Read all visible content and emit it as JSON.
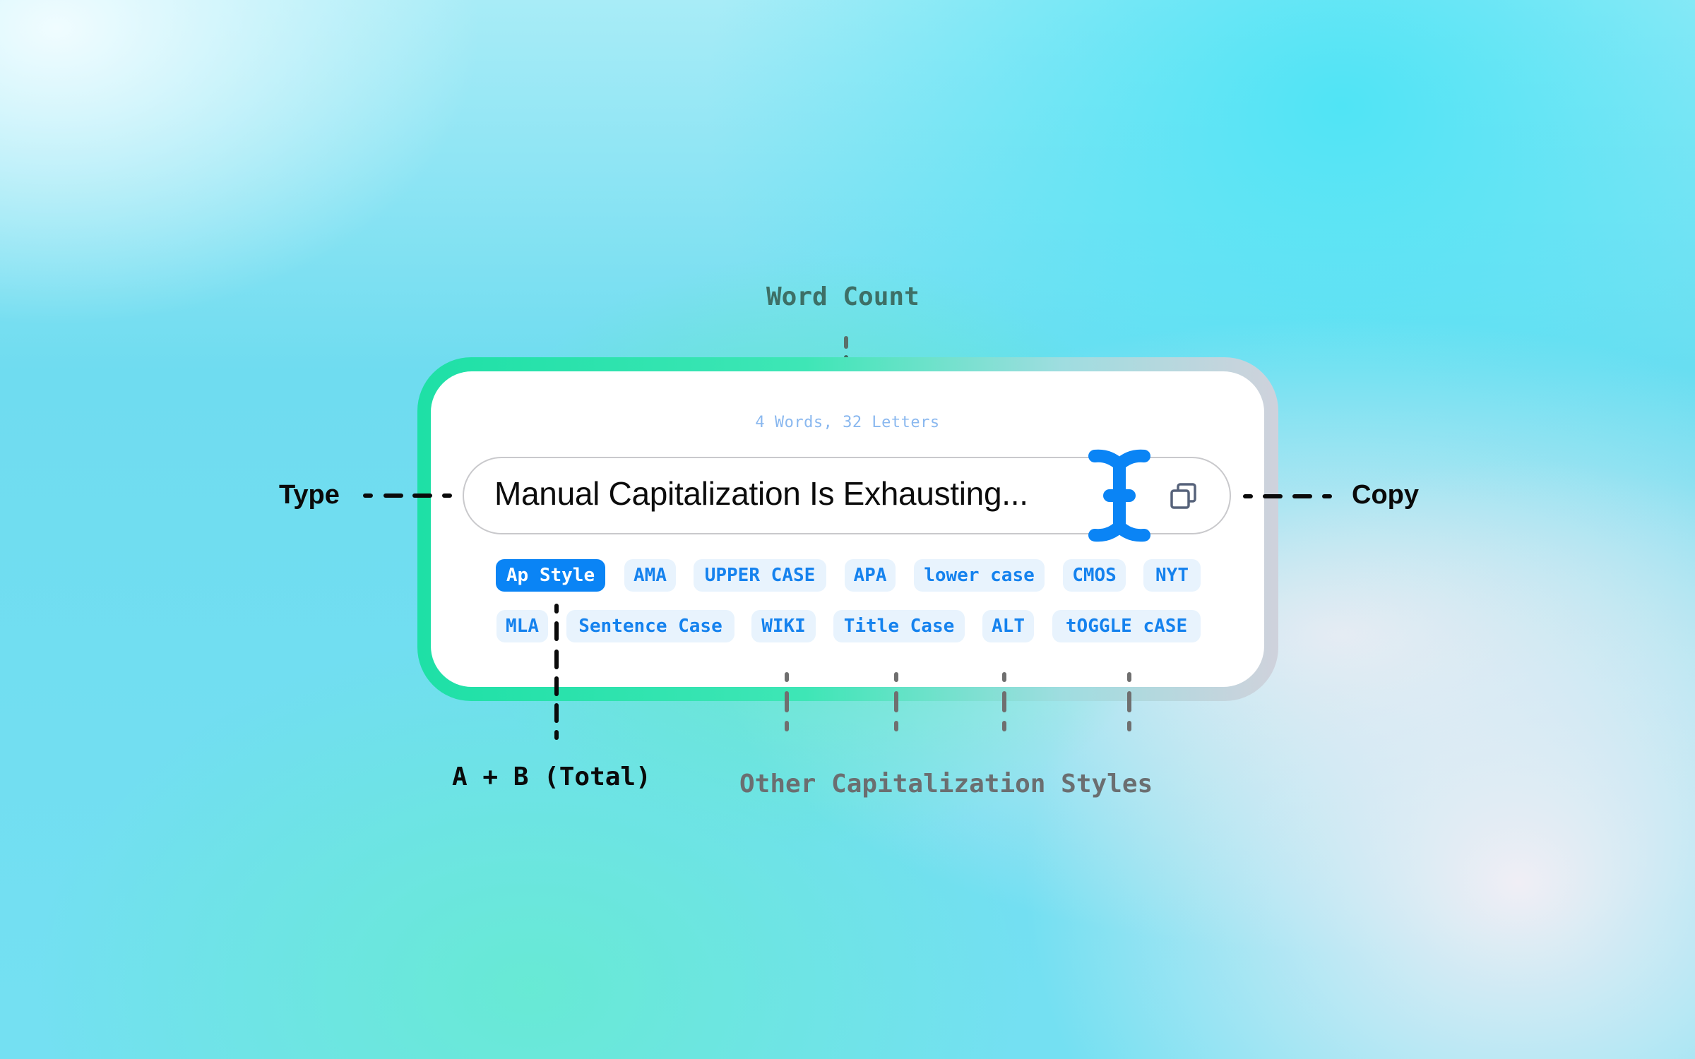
{
  "annotations": {
    "word_count": "Word Count",
    "type": "Type",
    "copy": "Copy",
    "total": "A + B (Total)",
    "other_styles": "Other Capitalization Styles"
  },
  "widget": {
    "word_count_text": "4 Words, 32 Letters",
    "input_value": "Manual Capitalization Is Exhausting...",
    "cursor_icon": "text-cursor-icon",
    "copy_icon": "copy-icon",
    "styles_row1": [
      {
        "label": "Ap Style",
        "active": true
      },
      {
        "label": "AMA",
        "active": false
      },
      {
        "label": "UPPER CASE",
        "active": false
      },
      {
        "label": "APA",
        "active": false
      },
      {
        "label": "lower case",
        "active": false
      },
      {
        "label": "CMOS",
        "active": false
      },
      {
        "label": "NYT",
        "active": false
      }
    ],
    "styles_row2": [
      {
        "label": "MLA",
        "active": false
      },
      {
        "label": "Sentence Case",
        "active": false
      },
      {
        "label": "WIKI",
        "active": false
      },
      {
        "label": "Title Case",
        "active": false
      },
      {
        "label": "ALT",
        "active": false
      },
      {
        "label": "tOGGLE cASE",
        "active": false
      }
    ]
  },
  "colors": {
    "accent": "#0a84f5",
    "chip_bg": "#e8f3fd",
    "chip_text": "#1582ee",
    "word_count_text": "#8ab8ef",
    "frame_green": "#1ee0a6"
  }
}
